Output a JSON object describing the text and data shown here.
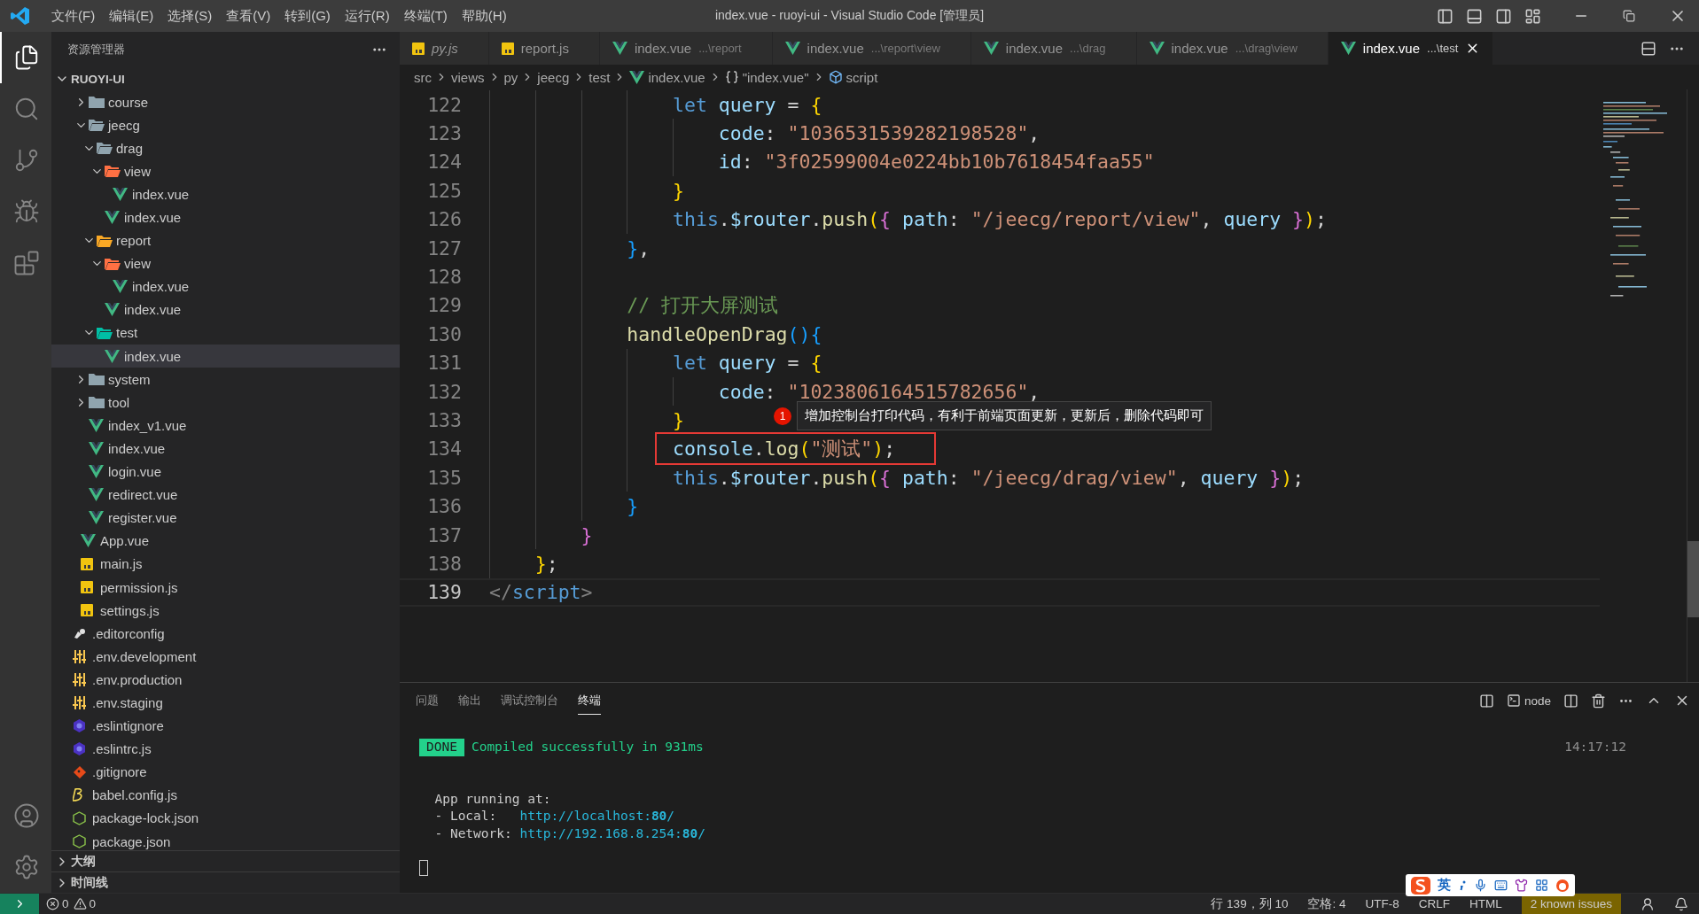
{
  "titlebar": {
    "menus": [
      "文件(F)",
      "编辑(E)",
      "选择(S)",
      "查看(V)",
      "转到(G)",
      "运行(R)",
      "终端(T)",
      "帮助(H)"
    ],
    "title": "index.vue - ruoyi-ui - Visual Studio Code [管理员]"
  },
  "activity_bar": [
    {
      "kind": "explorer",
      "selected": true
    },
    {
      "kind": "search",
      "selected": false
    },
    {
      "kind": "scm",
      "selected": false
    },
    {
      "kind": "debug",
      "selected": false
    },
    {
      "kind": "extensions",
      "selected": false
    }
  ],
  "activity_bar_bottom": [
    {
      "kind": "account"
    },
    {
      "kind": "settings"
    }
  ],
  "sidebar": {
    "title": "资源管理器",
    "section": {
      "name": "RUOYI-UI",
      "expanded": true
    },
    "tree": [
      {
        "children": [
          {
            "children": [
              {
                "name": "course",
                "kind": "folder",
                "color": "#90a4ae",
                "expanded": false,
                "selected": false
              },
              {
                "name": "jeecg",
                "kind": "folder",
                "color": "#90a4ae",
                "expanded": true,
                "selected": false,
                "children": [
                  {
                    "name": "drag",
                    "kind": "folder",
                    "color": "#90a4ae",
                    "expanded": true,
                    "selected": false,
                    "children": [
                      {
                        "name": "view",
                        "kind": "folder",
                        "color": "#ff7043",
                        "expanded": true,
                        "selected": false,
                        "children": [
                          {
                            "name": "index.vue",
                            "kind": "vue",
                            "selected": false
                          }
                        ]
                      },
                      {
                        "name": "index.vue",
                        "kind": "vue",
                        "selected": false
                      }
                    ]
                  },
                  {
                    "name": "report",
                    "kind": "folder",
                    "color": "#f9a825",
                    "expanded": true,
                    "selected": false,
                    "children": [
                      {
                        "name": "view",
                        "kind": "folder",
                        "color": "#ff7043",
                        "expanded": true,
                        "selected": false,
                        "children": [
                          {
                            "name": "index.vue",
                            "kind": "vue",
                            "selected": false
                          }
                        ]
                      },
                      {
                        "name": "index.vue",
                        "kind": "vue",
                        "selected": false
                      }
                    ]
                  },
                  {
                    "name": "test",
                    "kind": "folder",
                    "color": "#00bfa5",
                    "expanded": true,
                    "selected": false,
                    "children": [
                      {
                        "name": "index.vue",
                        "kind": "vue",
                        "selected": true
                      }
                    ]
                  }
                ]
              },
              {
                "name": "system",
                "kind": "folder",
                "color": "#90a4ae",
                "expanded": false,
                "selected": false
              },
              {
                "name": "tool",
                "kind": "folder",
                "color": "#90a4ae",
                "expanded": false,
                "selected": false
              },
              {
                "name": "index_v1.vue",
                "kind": "vue",
                "selected": false
              },
              {
                "name": "index.vue",
                "kind": "vue",
                "selected": false
              },
              {
                "name": "login.vue",
                "kind": "vue",
                "selected": false
              },
              {
                "name": "redirect.vue",
                "kind": "vue",
                "selected": false
              },
              {
                "name": "register.vue",
                "kind": "vue",
                "selected": false
              }
            ]
          },
          {
            "name": "App.vue",
            "kind": "vue",
            "selected": false
          },
          {
            "name": "main.js",
            "kind": "js",
            "selected": false
          },
          {
            "name": "permission.js",
            "kind": "js",
            "selected": false
          },
          {
            "name": "settings.js",
            "kind": "js",
            "selected": false
          }
        ]
      },
      {
        "name": ".editorconfig",
        "kind": "editorconfig",
        "selected": false
      },
      {
        "name": ".env.development",
        "kind": "env",
        "selected": false
      },
      {
        "name": ".env.production",
        "kind": "env",
        "selected": false
      },
      {
        "name": ".env.staging",
        "kind": "env",
        "selected": false
      },
      {
        "name": ".eslintignore",
        "kind": "eslint",
        "selected": false
      },
      {
        "name": ".eslintrc.js",
        "kind": "eslint",
        "selected": false
      },
      {
        "name": ".gitignore",
        "kind": "git",
        "selected": false
      },
      {
        "name": "babel.config.js",
        "kind": "babel",
        "selected": false
      },
      {
        "name": "package-lock.json",
        "kind": "npm",
        "selected": false
      },
      {
        "name": "package.json",
        "kind": "npm",
        "selected": false
      }
    ],
    "panels": [
      {
        "name": "大纲",
        "expanded": false
      },
      {
        "name": "时间线",
        "expanded": false
      }
    ]
  },
  "tabs": [
    {
      "label": "py.js",
      "kind": "js",
      "preview": true,
      "selected": false
    },
    {
      "label": "report.js",
      "kind": "js",
      "preview": false,
      "selected": false
    },
    {
      "label": "index.vue",
      "description": "...\\report",
      "kind": "vue",
      "preview": false,
      "selected": false
    },
    {
      "label": "index.vue",
      "description": "...\\report\\view",
      "kind": "vue",
      "preview": false,
      "selected": false
    },
    {
      "label": "index.vue",
      "description": "...\\drag",
      "kind": "vue",
      "preview": false,
      "selected": false
    },
    {
      "label": "index.vue",
      "description": "...\\drag\\view",
      "kind": "vue",
      "preview": false,
      "selected": false
    },
    {
      "label": "index.vue",
      "description": "...\\test",
      "kind": "vue",
      "preview": false,
      "selected": true
    }
  ],
  "breadcrumb": [
    {
      "kind": "folder",
      "text": "src"
    },
    {
      "kind": "folder",
      "text": "views"
    },
    {
      "kind": "folder",
      "text": "py"
    },
    {
      "kind": "folder",
      "text": "jeecg"
    },
    {
      "kind": "folder",
      "text": "test"
    },
    {
      "kind": "vue",
      "text": "index.vue"
    },
    {
      "kind": "object",
      "text": "\"index.vue\""
    },
    {
      "kind": "module",
      "text": "script"
    }
  ],
  "code": {
    "lines": [
      {
        "children": [
          {
            "children": [
              {
                "children": [
                  {
                    "children": [
                      {
                        "number": "122",
                        "current": false,
                        "tokens": [
                          {
                            "kind": "kw",
                            "text": "let "
                          },
                          {
                            "kind": "var",
                            "text": "query"
                          },
                          {
                            "kind": "p",
                            "text": " = "
                          },
                          {
                            "kind": "gold",
                            "text": "{"
                          }
                        ],
                        "children": [
                          {
                            "number": "123",
                            "current": false,
                            "tokens": [
                              {
                                "kind": "var",
                                "text": "code"
                              },
                              {
                                "kind": "p",
                                "text": ": "
                              },
                              {
                                "kind": "str",
                                "text": "\"1036531539282198528\""
                              },
                              {
                                "kind": "p",
                                "text": ","
                              }
                            ]
                          },
                          {
                            "number": "124",
                            "current": false,
                            "tokens": [
                              {
                                "kind": "var",
                                "text": "id"
                              },
                              {
                                "kind": "p",
                                "text": ": "
                              },
                              {
                                "kind": "str",
                                "text": "\"3f02599004e0224bb10b7618454faa55\""
                              }
                            ]
                          }
                        ]
                      },
                      {
                        "number": "125",
                        "current": false,
                        "tokens": [
                          {
                            "kind": "gold",
                            "text": "}"
                          }
                        ]
                      },
                      {
                        "number": "126",
                        "current": false,
                        "tokens": [
                          {
                            "kind": "kw",
                            "text": "this"
                          },
                          {
                            "kind": "p",
                            "text": "."
                          },
                          {
                            "kind": "var",
                            "text": "$router"
                          },
                          {
                            "kind": "p",
                            "text": "."
                          },
                          {
                            "kind": "fn",
                            "text": "push"
                          },
                          {
                            "kind": "gold",
                            "text": "("
                          },
                          {
                            "kind": "pink",
                            "text": "{ "
                          },
                          {
                            "kind": "var",
                            "text": "path"
                          },
                          {
                            "kind": "p",
                            "text": ": "
                          },
                          {
                            "kind": "str",
                            "text": "\"/jeecg/report/view\""
                          },
                          {
                            "kind": "p",
                            "text": ", "
                          },
                          {
                            "kind": "var",
                            "text": "query "
                          },
                          {
                            "kind": "pink",
                            "text": "}"
                          },
                          {
                            "kind": "gold",
                            "text": ")"
                          },
                          {
                            "kind": "p",
                            "text": ";"
                          }
                        ]
                      }
                    ]
                  },
                  {
                    "number": "127",
                    "current": false,
                    "tokens": [
                      {
                        "kind": "blue",
                        "text": "}"
                      },
                      {
                        "kind": "p",
                        "text": ","
                      }
                    ]
                  },
                  {
                    "number": "128",
                    "current": false
                  },
                  {
                    "number": "129",
                    "current": false,
                    "tokens": [
                      {
                        "kind": "cmt",
                        "text": "// 打开大屏测试"
                      }
                    ]
                  },
                  {
                    "number": "130",
                    "current": false,
                    "tokens": [
                      {
                        "kind": "fn",
                        "text": "handleOpenDrag"
                      },
                      {
                        "kind": "blue",
                        "text": "(){"
                      }
                    ],
                    "children": [
                      {
                        "number": "131",
                        "current": false,
                        "tokens": [
                          {
                            "kind": "kw",
                            "text": "let "
                          },
                          {
                            "kind": "var",
                            "text": "query"
                          },
                          {
                            "kind": "p",
                            "text": " = "
                          },
                          {
                            "kind": "gold",
                            "text": "{"
                          }
                        ],
                        "children": [
                          {
                            "number": "132",
                            "current": false,
                            "tokens": [
                              {
                                "kind": "var",
                                "text": "code"
                              },
                              {
                                "kind": "p",
                                "text": ": "
                              },
                              {
                                "kind": "str",
                                "text": "\"1023806164515782656\""
                              },
                              {
                                "kind": "p",
                                "text": ","
                              }
                            ]
                          }
                        ]
                      },
                      {
                        "number": "133",
                        "current": false,
                        "tokens": [
                          {
                            "kind": "gold",
                            "text": "}"
                          }
                        ]
                      },
                      {
                        "number": "134",
                        "current": false,
                        "boxed": true,
                        "tokens": [
                          {
                            "kind": "var",
                            "text": "console"
                          },
                          {
                            "kind": "p",
                            "text": "."
                          },
                          {
                            "kind": "fn",
                            "text": "log"
                          },
                          {
                            "kind": "gold",
                            "text": "("
                          },
                          {
                            "kind": "str",
                            "text": "\"测试\""
                          },
                          {
                            "kind": "gold",
                            "text": ")"
                          },
                          {
                            "kind": "p",
                            "text": ";"
                          }
                        ]
                      },
                      {
                        "number": "135",
                        "current": false,
                        "tokens": [
                          {
                            "kind": "kw",
                            "text": "this"
                          },
                          {
                            "kind": "p",
                            "text": "."
                          },
                          {
                            "kind": "var",
                            "text": "$router"
                          },
                          {
                            "kind": "p",
                            "text": "."
                          },
                          {
                            "kind": "fn",
                            "text": "push"
                          },
                          {
                            "kind": "gold",
                            "text": "("
                          },
                          {
                            "kind": "pink",
                            "text": "{ "
                          },
                          {
                            "kind": "var",
                            "text": "path"
                          },
                          {
                            "kind": "p",
                            "text": ": "
                          },
                          {
                            "kind": "str",
                            "text": "\"/jeecg/drag/view\""
                          },
                          {
                            "kind": "p",
                            "text": ", "
                          },
                          {
                            "kind": "var",
                            "text": "query "
                          },
                          {
                            "kind": "pink",
                            "text": "}"
                          },
                          {
                            "kind": "gold",
                            "text": ")"
                          },
                          {
                            "kind": "p",
                            "text": ";"
                          }
                        ]
                      }
                    ]
                  },
                  {
                    "number": "136",
                    "current": false,
                    "tokens": [
                      {
                        "kind": "blue",
                        "text": "}"
                      }
                    ]
                  }
                ]
              },
              {
                "number": "137",
                "current": false,
                "tokens": [
                  {
                    "kind": "pink",
                    "text": "}"
                  }
                ]
              }
            ]
          },
          {
            "number": "138",
            "current": false,
            "tokens": [
              {
                "kind": "gold",
                "text": "}"
              },
              {
                "kind": "p",
                "text": ";"
              }
            ]
          }
        ]
      },
      {
        "number": "139",
        "current": true,
        "tokens": [
          {
            "kind": "tag",
            "text": "</"
          },
          {
            "kind": "kw",
            "text": "script"
          },
          {
            "kind": "tag",
            "text": ">"
          }
        ]
      }
    ],
    "annotation": {
      "badge": "1",
      "text": "增加控制台打印代码，有利于前端页面更新，更新后，删除代码即可"
    }
  },
  "panel": {
    "tabs": [
      {
        "label": "问题",
        "selected": false
      },
      {
        "label": "输出",
        "selected": false
      },
      {
        "label": "调试控制台",
        "selected": false
      },
      {
        "label": "终端",
        "selected": true
      }
    ],
    "terminal_name": "node",
    "terminal": {
      "badge": "DONE",
      "message": "Compiled successfully in 931ms",
      "time": "14:17:12",
      "heading": "App running at:",
      "urls": [
        {
          "label": "- Local:",
          "url": "http://localhost:**80**/"
        },
        {
          "label": "- Network:",
          "url": "http://192.168.8.254:**80**/"
        }
      ]
    }
  },
  "status_bar": {
    "errors": "0",
    "warnings": "0",
    "items": [
      "行 139，列 10",
      "空格: 4",
      "UTF-8",
      "CRLF",
      "HTML"
    ],
    "issues": "2 known issues"
  },
  "ime_toolbar": {
    "mode": "英"
  }
}
